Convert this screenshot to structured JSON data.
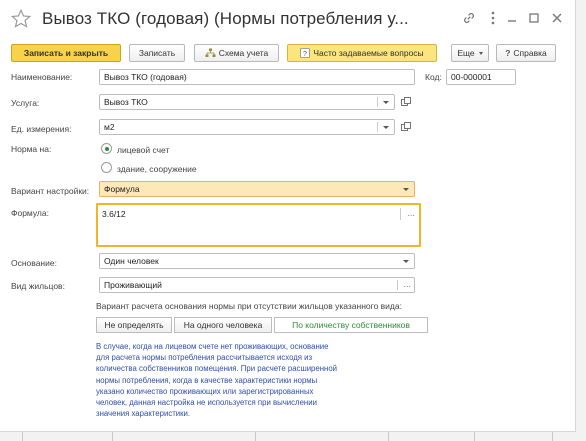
{
  "window": {
    "title": "Вывоз ТКО (годовая) (Нормы потребления у..."
  },
  "toolbar": {
    "save_close": "Записать и закрыть",
    "save": "Записать",
    "schema": "Схема учета",
    "faq": "Часто задаваемые вопросы",
    "more": "Еще",
    "help": "Справка"
  },
  "form": {
    "name_label": "Наименование:",
    "name_value": "Вывоз ТКО (годовая)",
    "code_label": "Код:",
    "code_value": "00-000001",
    "service_label": "Услуга:",
    "service_value": "Вывоз ТКО",
    "unit_label": "Ед. измерения:",
    "unit_value": "м2",
    "norm_label": "Норма на:",
    "norm_options": [
      "лицевой счет",
      "здание, сооружение"
    ],
    "norm_selected": "лицевой счет",
    "variant_label": "Вариант настройки:",
    "variant_value": "Формула",
    "formula_label": "Формула:",
    "formula_value": "3.6/12",
    "basis_label": "Основание:",
    "basis_value": "Один человек",
    "residents_label": "Вид жильцов:",
    "residents_value": "Проживающий",
    "calc_caption": "Вариант расчета основания нормы при отсутствии жильцов указанного вида:",
    "calc_options": [
      "Не определять",
      "На одного человека",
      "По количеству собственников"
    ],
    "calc_selected": "По количеству собственников",
    "note_lines": [
      "В случае, когда на лицевом счете нет проживающих, основание",
      "для расчета нормы потребления рассчитывается исходя из",
      "количества собственников помещения. При расчете расширенной",
      "нормы потребления, когда в качестве характеристики нормы",
      "указано количество проживающих или зарегистрированных",
      "человек, данная настройка не используется при вычислении",
      "значения характеристики."
    ]
  },
  "colors": {
    "primary_button": "#f7d34a",
    "highlight_field": "#fde8b8",
    "focus_border": "#f0b52a",
    "note_text": "#2f4fa8",
    "selected_green": "#2c8a3a"
  }
}
